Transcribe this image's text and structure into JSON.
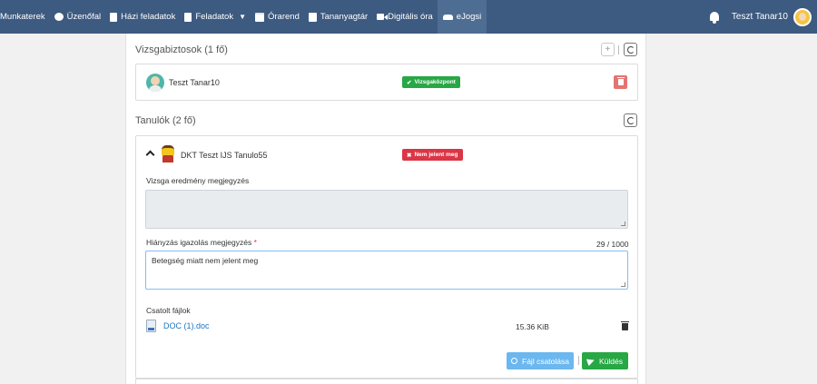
{
  "nav": {
    "items": [
      {
        "label": "Munkaterek",
        "icon": "workspace"
      },
      {
        "label": "Üzenőfal",
        "icon": "chat-icon"
      },
      {
        "label": "Házi feladatok",
        "icon": "document-icon"
      },
      {
        "label": "Feladatok",
        "icon": "document-icon"
      },
      {
        "label": "Órarend",
        "icon": "calendar-icon"
      },
      {
        "label": "Tananyagtár",
        "icon": "book-icon"
      },
      {
        "label": "Digitális óra",
        "icon": "video-icon"
      },
      {
        "label": "eJogsi",
        "icon": "car-icon"
      }
    ],
    "user_name": "Teszt Tanar10",
    "colors": {
      "bar": "#3d5a80",
      "active": "#4e6d93"
    }
  },
  "examiners": {
    "title": "Vizsgabiztosok (1 fő)",
    "add_symbol": "+",
    "row": {
      "name": "Teszt Tanar10",
      "badge": "Vizsgaközpont",
      "badge_color": "#28a745"
    }
  },
  "students": {
    "title": "Tanulók (2 fő)",
    "row": {
      "name": "DKT Teszt IJS Tanulo55",
      "badge": "Nem jelent meg",
      "badge_color": "#dc3545",
      "result_label": "Vizsga eredmény megjegyzés",
      "result_value": "",
      "absence_label": "Hiányzás igazolás megjegyzés",
      "absence_required": "*",
      "absence_value": "Betegség miatt nem jelent meg",
      "counter": "29 / 1000",
      "files_label": "Csatolt fájlok",
      "files": [
        {
          "name": "DOC (1).doc",
          "size": "15.36 KiB",
          "icon": "doc-file-icon"
        }
      ],
      "attach_button": "Fájl csatolása",
      "send_button": "Küldés"
    }
  }
}
